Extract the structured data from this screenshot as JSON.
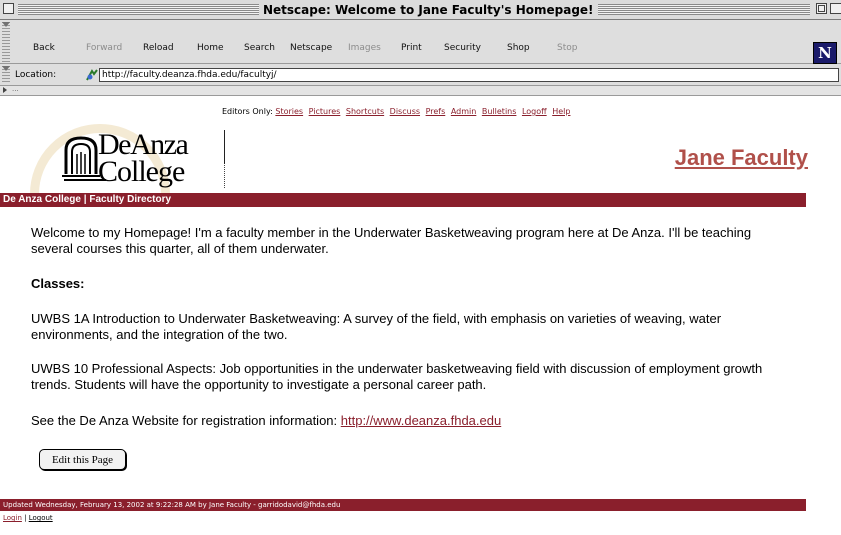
{
  "window": {
    "title": "Netscape: Welcome to Jane Faculty's Homepage!"
  },
  "toolbar": {
    "back": "Back",
    "forward": "Forward",
    "reload": "Reload",
    "home": "Home",
    "search": "Search",
    "netscape": "Netscape",
    "images": "Images",
    "print": "Print",
    "security": "Security",
    "shop": "Shop",
    "stop": "Stop",
    "logo": "N"
  },
  "location": {
    "label": "Location:",
    "url": "http://faculty.deanza.fhda.edu/facultyj/"
  },
  "personal_bar": {
    "dots": "..."
  },
  "editors": {
    "label": "Editors Only:",
    "links": [
      "Stories",
      "Pictures",
      "Shortcuts",
      "Discuss",
      "Prefs",
      "Admin",
      "Bulletins",
      "Logoff",
      "Help"
    ]
  },
  "logo": {
    "line1": "DeAnza",
    "line2": "College"
  },
  "header": {
    "name": "Jane Faculty",
    "directory_bar": "De Anza College | Faculty Directory"
  },
  "content": {
    "intro": "Welcome to my Homepage! I'm a faculty member in the Underwater Basketweaving program here at De Anza. I'll be teaching several courses this quarter, all of them underwater.",
    "classes_heading": "Classes:",
    "class1": "UWBS 1A Introduction to Underwater Basketweaving: A survey of the field, with emphasis on varieties of weaving, water environments, and the integration of the two.",
    "class2": "UWBS 10 Professional Aspects: Job opportunities in the underwater basketweaving field with discussion of employment growth trends. Students will have the opportunity to investigate a personal career path.",
    "registration_text": "See the De Anza Website for registration information: ",
    "registration_link": "http://www.deanza.fhda.edu",
    "edit_button": "Edit this Page"
  },
  "footer": {
    "updated": "Updated Wednesday, February 13, 2002 at 9:22:28 AM by Jane Faculty - garridodavid@fhda.edu",
    "login": "Login",
    "separator": " | ",
    "logout": "Logout"
  },
  "colors": {
    "accent": "#8a1f2c",
    "name_heading": "#b0504a"
  }
}
